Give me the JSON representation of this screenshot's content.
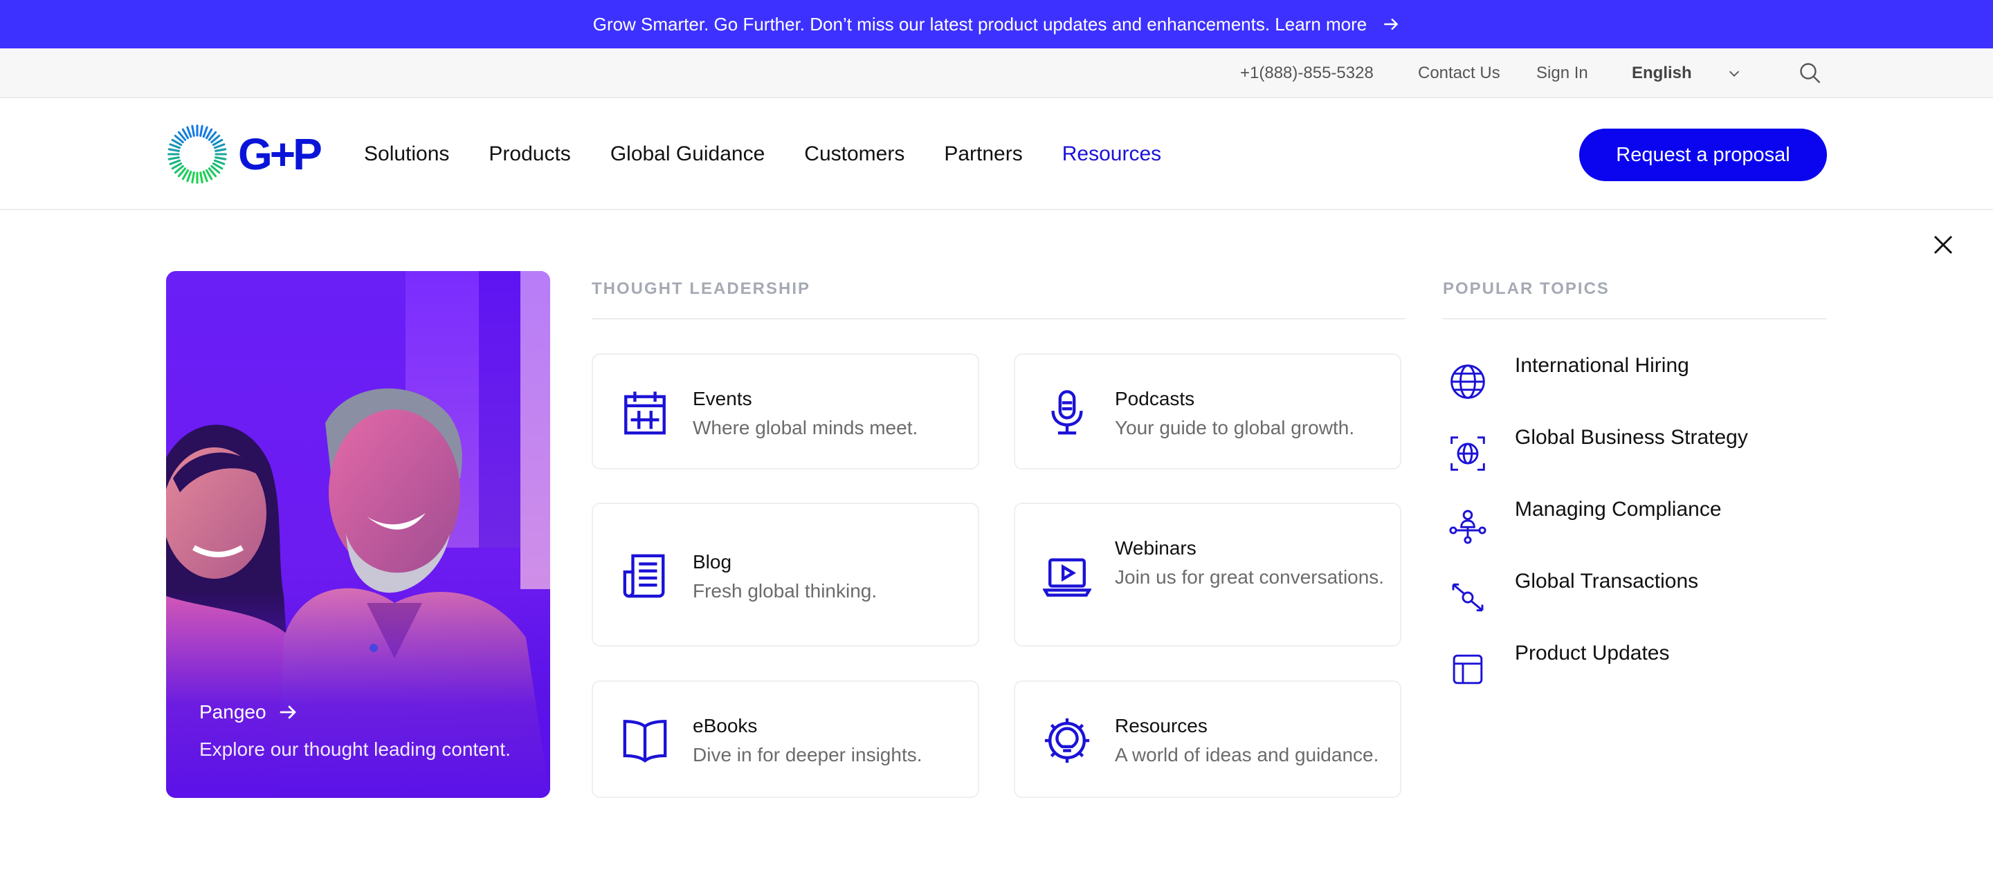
{
  "announcement": {
    "text": "Grow Smarter. Go Further. Don’t miss our latest product updates and enhancements. Learn more",
    "icon": "arrow-right-icon"
  },
  "utility": {
    "phone": "+1(888)-855-5328",
    "contact": "Contact Us",
    "signin": "Sign In",
    "language": "English",
    "search_icon": "search-icon"
  },
  "brand": {
    "logo_text": "G+P",
    "colors": {
      "primary": "#0a05ee",
      "announcement": "#3d31ff",
      "icon": "#1b12d6"
    }
  },
  "nav": {
    "items": [
      {
        "label": "Solutions"
      },
      {
        "label": "Products"
      },
      {
        "label": "Global Guidance"
      },
      {
        "label": "Customers"
      },
      {
        "label": "Partners"
      },
      {
        "label": "Resources",
        "active": true
      }
    ],
    "cta": "Request a proposal"
  },
  "mega": {
    "feature": {
      "title": "Pangeo",
      "description": "Explore our thought leading content."
    },
    "thought_leadership": {
      "heading": "THOUGHT LEADERSHIP",
      "cards": [
        {
          "title": "Events",
          "description": "Where global minds meet.",
          "icon": "calendar-icon"
        },
        {
          "title": "Podcasts",
          "description": "Your guide to global growth.",
          "icon": "microphone-icon"
        },
        {
          "title": "Blog",
          "description": "Fresh global thinking.",
          "icon": "newspaper-icon"
        },
        {
          "title": "Webinars",
          "description": "Join us for great conversations.",
          "icon": "laptop-play-icon"
        },
        {
          "title": "eBooks",
          "description": "Dive in for deeper insights.",
          "icon": "open-book-icon"
        },
        {
          "title": "Resources",
          "description": "A world of ideas and guidance.",
          "icon": "lightbulb-gear-icon"
        }
      ]
    },
    "popular_topics": {
      "heading": "POPULAR TOPICS",
      "items": [
        {
          "label": "International Hiring",
          "icon": "globe-icon"
        },
        {
          "label": "Global Business Strategy",
          "icon": "target-globe-icon"
        },
        {
          "label": "Managing Compliance",
          "icon": "network-people-icon"
        },
        {
          "label": "Global Transactions",
          "icon": "exchange-arrows-icon"
        },
        {
          "label": "Product Updates",
          "icon": "layout-panel-icon"
        }
      ]
    }
  }
}
